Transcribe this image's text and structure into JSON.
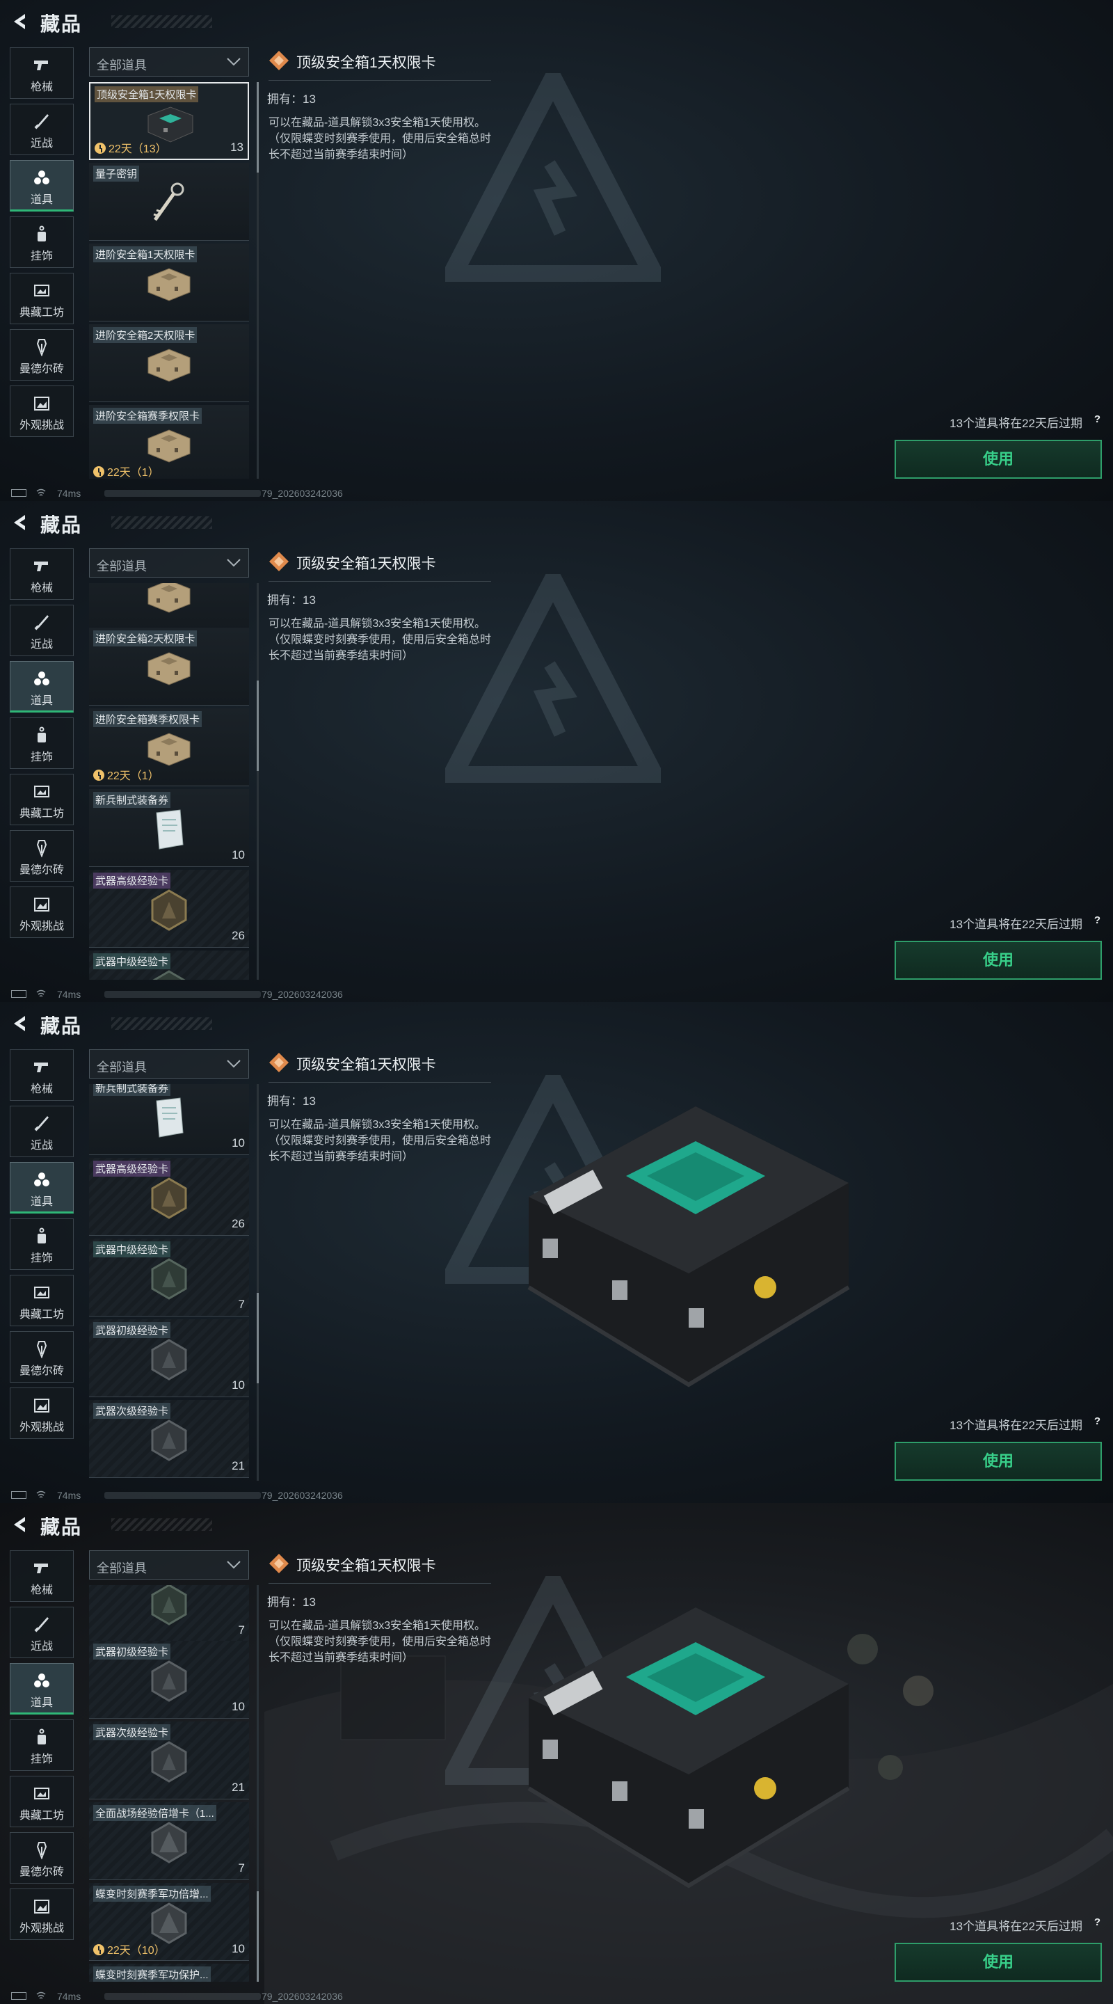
{
  "header": {
    "title": "藏品"
  },
  "sidebar": [
    {
      "label": "枪械",
      "icon": "pistol-icon"
    },
    {
      "label": "近战",
      "icon": "knife-icon"
    },
    {
      "label": "道具",
      "icon": "items-icon",
      "active": true
    },
    {
      "label": "挂饰",
      "icon": "charm-icon"
    },
    {
      "label": "典藏工坊",
      "icon": "workshop-icon"
    },
    {
      "label": "曼德尔砖",
      "icon": "mandel-brick-icon"
    },
    {
      "label": "外观挑战",
      "icon": "appearance-challenge-icon"
    }
  ],
  "filter": {
    "label": "全部道具"
  },
  "detail": {
    "title": "顶级安全箱1天权限卡",
    "owned": "拥有：13",
    "description": "可以在藏品-道具解锁3x3安全箱1天使用权。（仅限蝶变时刻赛季使用，使用后安全箱总时长不超过当前赛季结束时间）",
    "expire_note": "13个道具将在22天后过期",
    "help": "?",
    "use_button": "使用"
  },
  "status": {
    "ping": "74ms",
    "uid": "79_202603242036"
  },
  "frames": [
    {
      "items": [
        {
          "name": "顶级安全箱1天权限卡",
          "count": "13",
          "time": "22天（13）",
          "img": "case-teal",
          "selected": true
        },
        {
          "name": "量子密钥",
          "count": "",
          "time": "",
          "img": "key"
        },
        {
          "name": "进阶安全箱1天权限卡",
          "count": "",
          "time": "",
          "img": "case-tan"
        },
        {
          "name": "进阶安全箱2天权限卡",
          "count": "",
          "time": "",
          "img": "case-tan"
        },
        {
          "name": "进阶安全箱赛季权限卡",
          "count": "",
          "time": "22天（1）",
          "img": "case-tan"
        }
      ]
    },
    {
      "items": [
        {
          "name": "",
          "count": "",
          "time": "",
          "img": "case-tan"
        },
        {
          "name": "进阶安全箱2天权限卡",
          "count": "",
          "time": "",
          "img": "case-tan"
        },
        {
          "name": "进阶安全箱赛季权限卡",
          "count": "",
          "time": "22天（1）",
          "img": "case-tan"
        },
        {
          "name": "新兵制式装备券",
          "count": "10",
          "time": "",
          "img": "paper"
        },
        {
          "name": "武器高级经验卡",
          "count": "26",
          "time": "",
          "img": "hex-gold",
          "tag": "purple"
        },
        {
          "name": "武器中级经验卡",
          "count": "",
          "time": "",
          "img": "hex-green",
          "tag": "teal"
        }
      ]
    },
    {
      "items": [
        {
          "name": "新兵制式装备券",
          "count": "10",
          "time": "",
          "img": "paper"
        },
        {
          "name": "武器高级经验卡",
          "count": "26",
          "time": "",
          "img": "hex-gold",
          "tag": "purple"
        },
        {
          "name": "武器中级经验卡",
          "count": "7",
          "time": "",
          "img": "hex-green",
          "tag": "teal"
        },
        {
          "name": "武器初级经验卡",
          "count": "10",
          "time": "",
          "img": "hex-grey"
        },
        {
          "name": "武器次级经验卡",
          "count": "21",
          "time": "",
          "img": "hex-grey"
        }
      ]
    },
    {
      "items": [
        {
          "name": "",
          "count": "7",
          "time": "",
          "img": "hex-green"
        },
        {
          "name": "武器初级经验卡",
          "count": "10",
          "time": "",
          "img": "hex-grey"
        },
        {
          "name": "武器次级经验卡",
          "count": "21",
          "time": "",
          "img": "hex-grey"
        },
        {
          "name": "全面战场经验倍增卡（1...",
          "count": "7",
          "time": "",
          "img": "card-grey"
        },
        {
          "name": "蝶变时刻赛季军功倍增...",
          "count": "10",
          "time": "22天（10）",
          "img": "card-grey"
        },
        {
          "name": "蝶变时刻赛季军功保护...",
          "count": "",
          "time": "",
          "img": "card-grey"
        }
      ]
    }
  ]
}
